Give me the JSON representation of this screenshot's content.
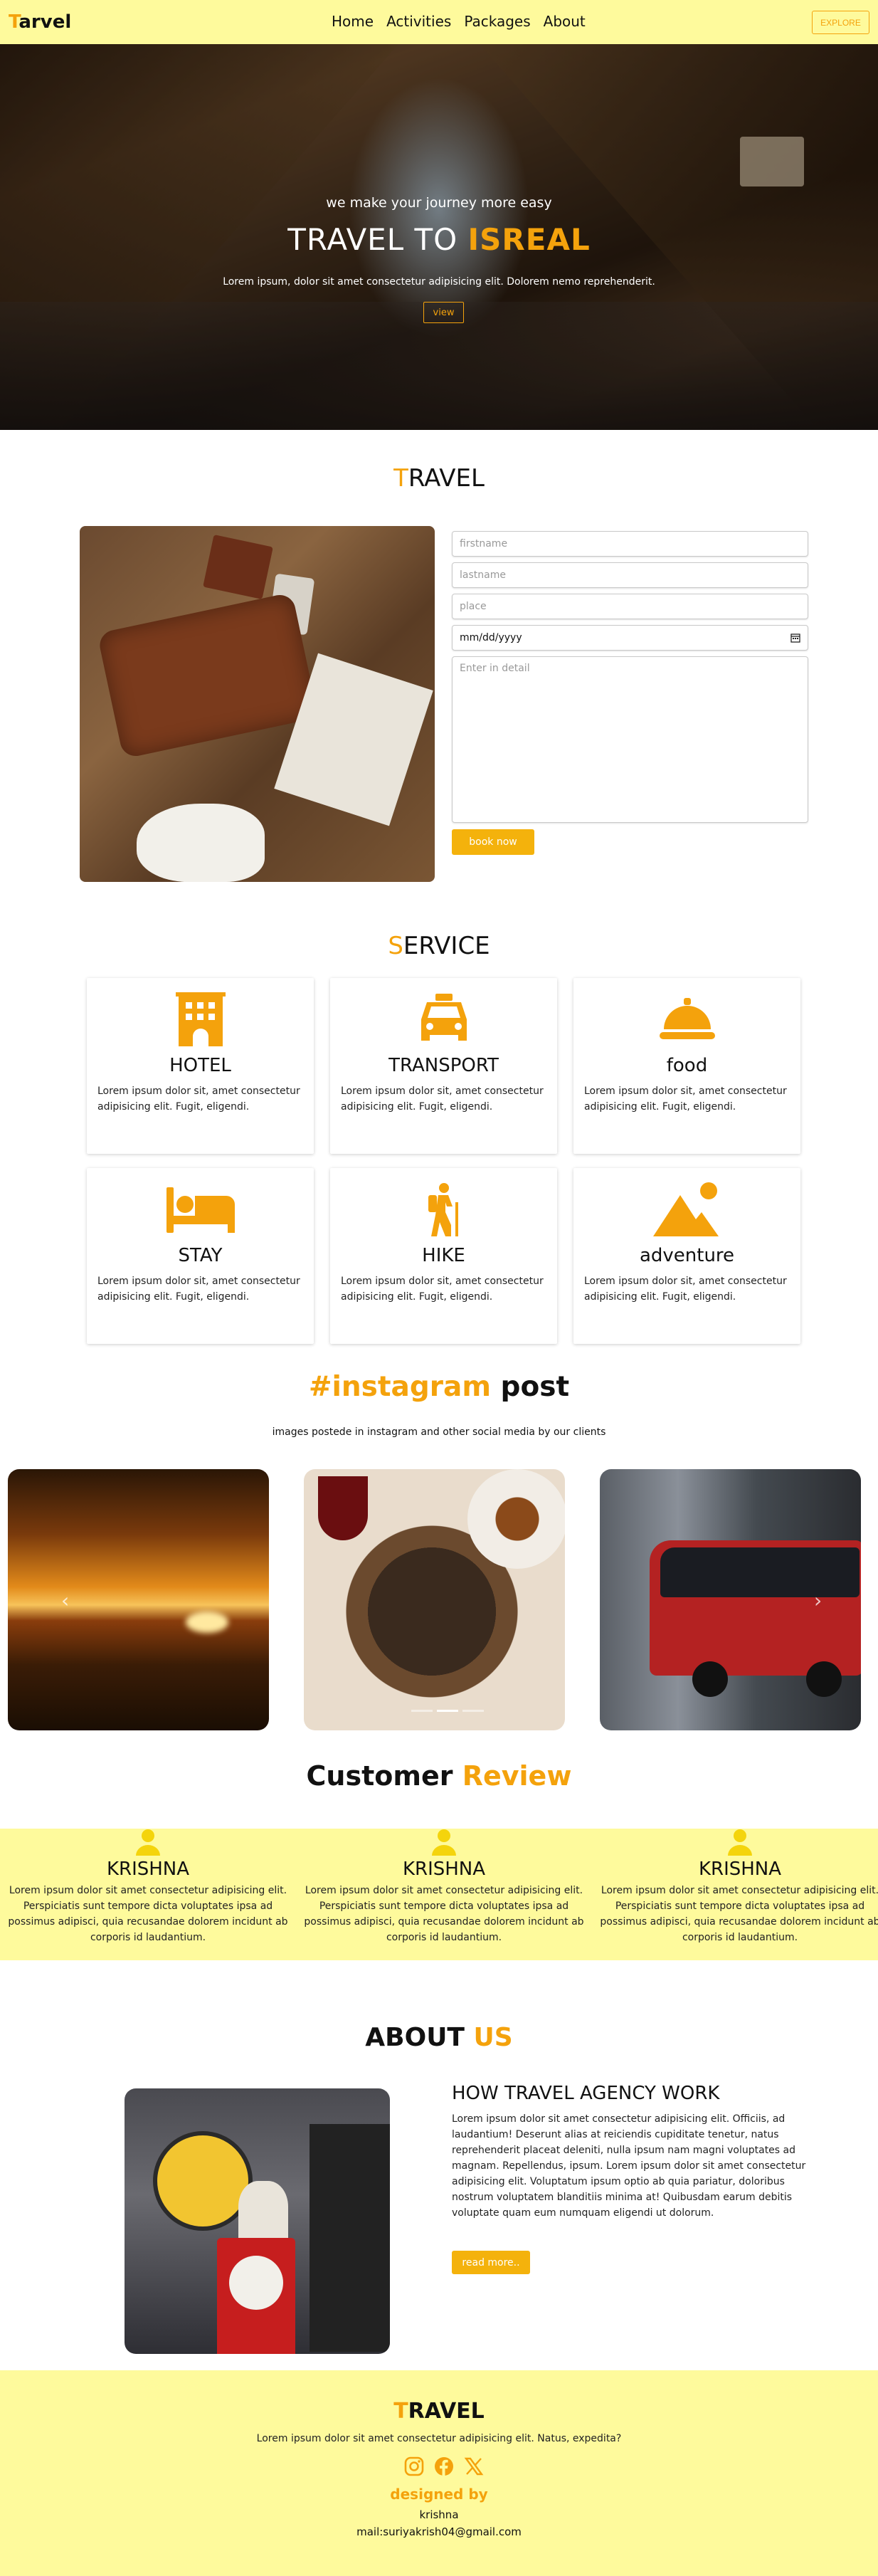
{
  "nav": {
    "logo_first": "T",
    "logo_rest": "arvel",
    "links": [
      "Home",
      "Activities",
      "Packages",
      "About"
    ],
    "explore": "EXPLORE"
  },
  "hero": {
    "subtitle": "we make your journey more easy",
    "title_prefix": "TRAVEL TO ",
    "title_accent": "ISREAL",
    "description": "Lorem ipsum, dolor sit amet consectetur adipisicing elit. Dolorem nemo reprehenderit.",
    "button": "view"
  },
  "travel": {
    "title_first": "T",
    "title_rest": "RAVEL",
    "form": {
      "firstname_placeholder": "firstname",
      "lastname_placeholder": "lastname",
      "place_placeholder": "place",
      "date_value": "mm/dd/yyyy",
      "detail_placeholder": "Enter in detail",
      "submit": "book now"
    }
  },
  "service": {
    "title_first": "S",
    "title_rest": "ERVICE",
    "cards": [
      {
        "title": "HOTEL",
        "icon": "hotel-icon",
        "desc": "Lorem ipsum dolor sit, amet consectetur adipisicing elit. Fugit, eligendi."
      },
      {
        "title": "TRANSPORT",
        "icon": "taxi-icon",
        "desc": "Lorem ipsum dolor sit, amet consectetur adipisicing elit. Fugit, eligendi."
      },
      {
        "title": "food",
        "icon": "cloche-icon",
        "desc": "Lorem ipsum dolor sit, amet consectetur adipisicing elit. Fugit, eligendi."
      },
      {
        "title": "STAY",
        "icon": "bed-icon",
        "desc": "Lorem ipsum dolor sit, amet consectetur adipisicing elit. Fugit, eligendi."
      },
      {
        "title": "HIKE",
        "icon": "hiker-icon",
        "desc": "Lorem ipsum dolor sit, amet consectetur adipisicing elit. Fugit, eligendi."
      },
      {
        "title": "adventure",
        "icon": "mountain-icon",
        "desc": "Lorem ipsum dolor sit, amet consectetur adipisicing elit. Fugit, eligendi."
      }
    ]
  },
  "instagram": {
    "title_accent": "#instagram",
    "title_rest": " post",
    "subtitle": "images postede in instagram and other social media by our clients",
    "prev": "‹",
    "next": "›"
  },
  "reviews": {
    "title_main": "Customer ",
    "title_accent": "Review",
    "items": [
      {
        "name": "KRISHNA",
        "text": "Lorem ipsum dolor sit amet consectetur adipisicing elit. Perspiciatis sunt tempore dicta voluptates ipsa ad possimus adipisci, quia recusandae dolorem incidunt ab corporis id laudantium."
      },
      {
        "name": "KRISHNA",
        "text": "Lorem ipsum dolor sit amet consectetur adipisicing elit. Perspiciatis sunt tempore dicta voluptates ipsa ad possimus adipisci, quia recusandae dolorem incidunt ab corporis id laudantium."
      },
      {
        "name": "KRISHNA",
        "text": "Lorem ipsum dolor sit amet consectetur adipisicing elit. Perspiciatis sunt tempore dicta voluptates ipsa ad possimus adipisci, quia recusandae dolorem incidunt ab corporis id laudantium."
      }
    ]
  },
  "about": {
    "title_main": "ABOUT ",
    "title_accent": "US",
    "heading": "HOW TRAVEL AGENCY WORK",
    "body": "Lorem ipsum dolor sit amet consectetur adipisicing elit. Officiis, ad laudantium! Deserunt alias at reiciendis cupiditate tenetur, natus reprehenderit placeat deleniti, nulla ipsum nam magni voluptates ad magnam. Repellendus, ipsum. Lorem ipsum dolor sit amet consectetur adipisicing elit. Voluptatum ipsum optio ab quia pariatur, doloribus nostrum voluptatem blanditiis minima at! Quibusdam earum debitis voluptate quam eum numquam eligendi ut dolorum.",
    "button": "read more.."
  },
  "footer": {
    "brand_first": "T",
    "brand_rest": "RAVEL",
    "tagline": "Lorem ipsum dolor sit amet consectetur adipisicing elit. Natus, expedita?",
    "designed_by": "designed by",
    "author": "krishna",
    "mail": "mail:suriyakrish04@gmail.com"
  },
  "colors": {
    "accent": "#f4a20c",
    "band": "#fefa9c"
  }
}
